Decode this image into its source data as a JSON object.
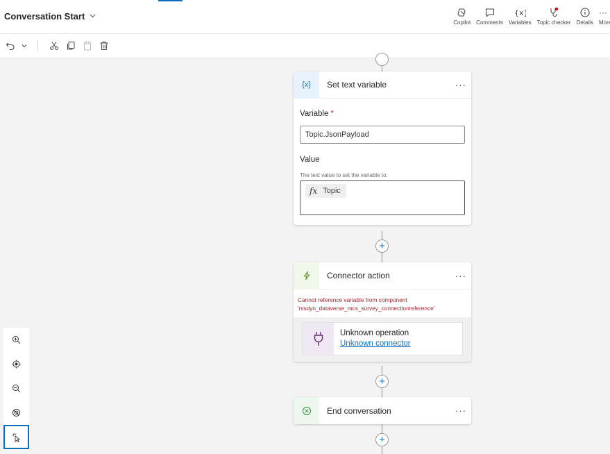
{
  "header": {
    "title": "Conversation Start",
    "tools": [
      {
        "label": "Copilot",
        "icon": "copilot-icon"
      },
      {
        "label": "Comments",
        "icon": "comment-icon"
      },
      {
        "label": "Variables",
        "icon": "variables-icon"
      },
      {
        "label": "Topic checker",
        "icon": "stethoscope-icon"
      },
      {
        "label": "Details",
        "icon": "info-icon"
      },
      {
        "label": "More",
        "icon": "more-icon"
      }
    ]
  },
  "toolbar": {
    "icons": [
      "undo-icon",
      "chevron-down-icon",
      "cut-icon",
      "copy-icon",
      "paste-icon",
      "delete-icon"
    ]
  },
  "nodes": {
    "set_text": {
      "icon_text": "{x}",
      "title": "Set text variable",
      "more": "···",
      "variable_label": "Variable",
      "required_mark": "*",
      "variable_value": "Topic.JsonPayload",
      "value_label": "Value",
      "value_hint": "The text value to set the variable to.",
      "formula_fx": "fx",
      "formula_value": "Topic"
    },
    "connector": {
      "title": "Connector action",
      "more": "···",
      "error_line1": "Cannot reference variable from component",
      "error_line2": "'msdyn_dataverse_mcs_survey_connectionreference'",
      "operation": "Unknown operation",
      "connector_link": "Unknown connector"
    },
    "end": {
      "title": "End conversation",
      "more": "···"
    }
  },
  "plus_label": "+",
  "zoom_controls": [
    "zoom-in-icon",
    "fit-view-icon",
    "zoom-out-icon",
    "minimap-off-icon",
    "select-pointer-icon"
  ],
  "colors": {
    "accent": "#0f6cbd",
    "error": "#a4262c",
    "connector_icon_bg": "#efe7f2",
    "set_variable_icon_bg": "#e8f2fc",
    "connector_action_icon_bg": "#f1f8ea",
    "end_icon_bg": "#eef7ee"
  }
}
